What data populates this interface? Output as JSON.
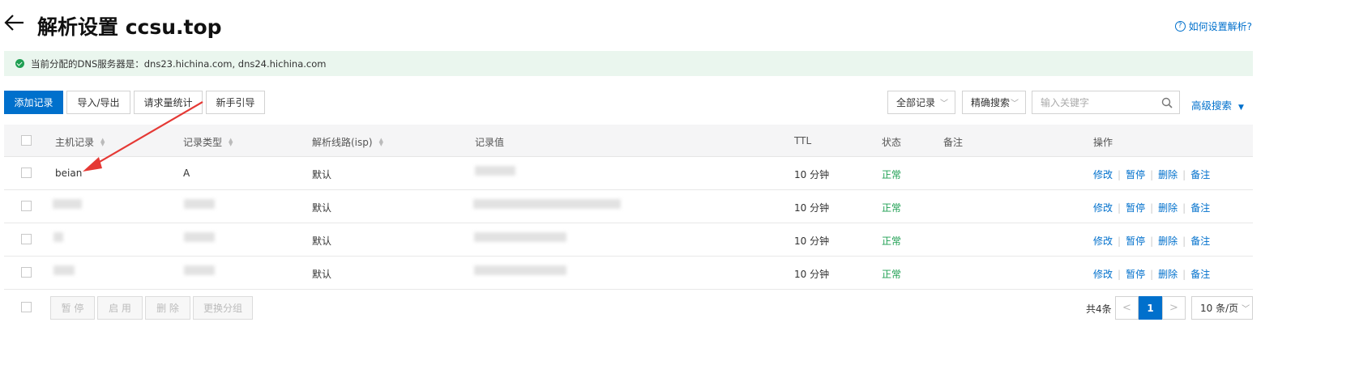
{
  "header": {
    "back_icon": "arrow-left-icon",
    "title": "解析设置 ccsu.top",
    "help_label": "如何设置解析?",
    "help_icon": "question-circle-icon"
  },
  "info": {
    "icon": "check-circle-icon",
    "text": "当前分配的DNS服务器是：dns23.hichina.com, dns24.hichina.com"
  },
  "toolbar": {
    "add_label": "添加记录",
    "import_label": "导入/导出",
    "stats_label": "请求量统计",
    "guide_label": "新手引导",
    "filter_label": "全部记录",
    "mode_label": "精确搜索",
    "search_placeholder": "输入关键字",
    "advanced_label": "高级搜索"
  },
  "table": {
    "columns": [
      "主机记录",
      "记录类型",
      "解析线路(isp)",
      "记录值",
      "TTL",
      "状态",
      "备注",
      "操作"
    ],
    "rows": [
      {
        "host": "beian",
        "type": "A",
        "line": "默认",
        "value": "",
        "ttl": "10 分钟",
        "status": "正常",
        "note": ""
      },
      {
        "host": "",
        "type": "",
        "line": "默认",
        "value": "",
        "ttl": "10 分钟",
        "status": "正常",
        "note": ""
      },
      {
        "host": "",
        "type": "",
        "line": "默认",
        "value": "",
        "ttl": "10 分钟",
        "status": "正常",
        "note": ""
      },
      {
        "host": "",
        "type": "",
        "line": "默认",
        "value": "",
        "ttl": "10 分钟",
        "status": "正常",
        "note": ""
      }
    ],
    "actions": [
      "修改",
      "暂停",
      "删除",
      "备注"
    ]
  },
  "footer": {
    "pause_label": "暂 停",
    "enable_label": "启 用",
    "delete_label": "删 除",
    "group_label": "更换分组",
    "total": "共4条",
    "page": "1",
    "page_size": "10 条/页"
  },
  "colors": {
    "accent": "#0070cc",
    "success": "#1e9f52",
    "annotation_arrow": "#e53935"
  }
}
